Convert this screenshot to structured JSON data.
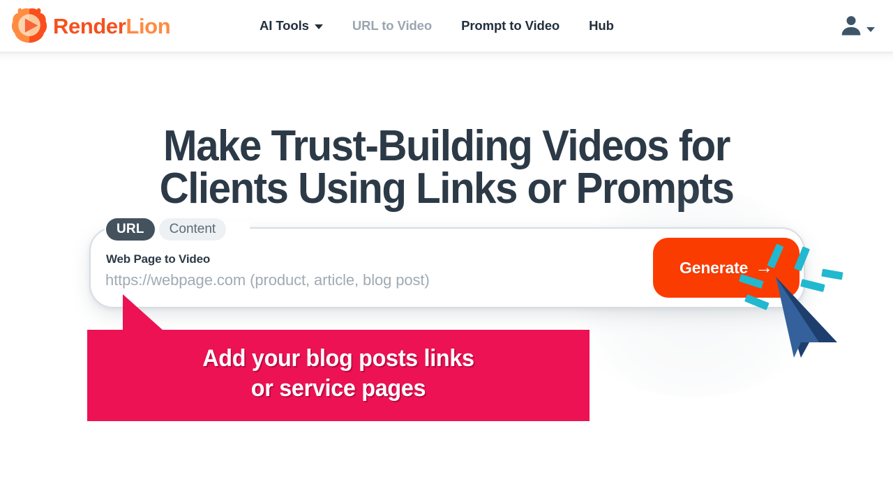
{
  "header": {
    "brand": {
      "logo_icon": "lion-play-logo",
      "name_part1": "Render",
      "name_part2": "Lion",
      "color_part1": "#f4511e",
      "color_part2": "#ff8a42"
    },
    "nav": [
      {
        "label": "AI Tools",
        "has_caret": true,
        "muted": false
      },
      {
        "label": "URL to Video",
        "has_caret": false,
        "muted": true
      },
      {
        "label": "Prompt to Video",
        "has_caret": false,
        "muted": false
      },
      {
        "label": "Hub",
        "has_caret": false,
        "muted": false
      }
    ],
    "account": {
      "icon": "user-account-icon",
      "caret_icon": "chevron-down-icon"
    }
  },
  "hero": {
    "title_line1": "Make Trust-Building Videos for",
    "title_line2": "Clients Using Links or Prompts",
    "title_color": "#2c3a47"
  },
  "input_card": {
    "tabs": [
      {
        "label": "URL",
        "active": true
      },
      {
        "label": "Content",
        "active": false
      }
    ],
    "field_label": "Web Page to Video",
    "field_value": "",
    "field_placeholder": "https://webpage.com (product, article, blog post)",
    "generate_button": {
      "label": "Generate",
      "arrow_icon": "arrow-right-icon",
      "color": "#fb3c00"
    },
    "active_tab_color": "#44525e",
    "inactive_tab_color": "#eef1f3"
  },
  "pointer_overlay": {
    "cursor_icon": "mouse-cursor-arrow",
    "click_burst_icon": "click-burst-rays",
    "cursor_color": "#2f5c96",
    "cursor_shadow_color": "#1e3f6e",
    "burst_color": "#22b8cf"
  },
  "callout": {
    "line1": "Add your blog posts links",
    "line2": "or  service pages",
    "background_color": "#ec1254",
    "text_color": "#ffffff"
  }
}
